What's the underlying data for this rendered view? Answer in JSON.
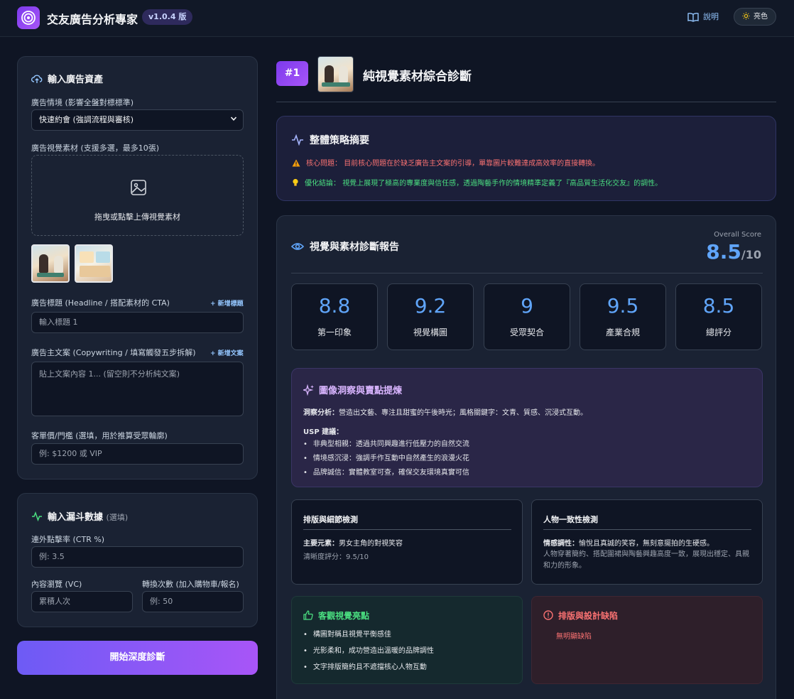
{
  "header": {
    "app_title": "交友廣告分析專家",
    "version": "v1.0.4 版",
    "help_label": "說明",
    "theme_label": "亮色"
  },
  "input_panel": {
    "title": "輸入廣告資產",
    "scenario_label": "廣告情境 (影響全盤對標標準)",
    "scenario_value": "快速約會 (強調流程與審核)",
    "visual_label": "廣告視覺素材 (支援多選，最多10張)",
    "dropzone_text": "拖曳或點擊上傳視覺素材",
    "headline_label": "廣告標題 (Headline / 搭配素材的 CTA)",
    "add_headline": "+ 新增標題",
    "headline_placeholder": "輸入標題 1",
    "copy_label": "廣告主文案 (Copywriting / 填寫觸發五步拆解)",
    "add_copy": "+ 新增文案",
    "copy_placeholder": "貼上文案內容 1... (留空則不分析純文案)",
    "price_label": "客單價/門檻 (選填，用於推算受眾輪廓)",
    "price_placeholder": "例: $1200 或 VIP"
  },
  "funnel_panel": {
    "title": "輸入漏斗數據",
    "optional": "(選填)",
    "ctr_label": "連外點擊率 (CTR %)",
    "ctr_placeholder": "例: 3.5",
    "vc_label": "內容瀏覽 (VC)",
    "vc_placeholder": "累積人次",
    "conv_label": "轉換次數 (加入購物車/報名)",
    "conv_placeholder": "例: 50"
  },
  "start_button": "開始深度診斷",
  "report_header": {
    "rank": "#1",
    "title": "純視覺素材綜合診斷"
  },
  "summary": {
    "title": "整體策略摘要",
    "core_label": "核心問題：",
    "core_text": "目前核心問題在於缺乏廣告主文案的引導，單靠圖片較難達成高效率的直接轉換。",
    "opt_label": "優化結論：",
    "opt_text": "視覺上展現了極高的專業度與信任感，透過陶藝手作的情境精準定義了『高品質生活化交友』的調性。"
  },
  "report": {
    "title": "視覺與素材診斷報告",
    "overall_label": "Overall Score",
    "overall_value": "8.5",
    "overall_denominator": "/10",
    "scores": [
      {
        "value": "8.8",
        "label": "第一印象"
      },
      {
        "value": "9.2",
        "label": "視覺構圖"
      },
      {
        "value": "9",
        "label": "受眾契合"
      },
      {
        "value": "9.5",
        "label": "產業合規"
      },
      {
        "value": "8.5",
        "label": "總評分"
      }
    ]
  },
  "insight": {
    "title": "圖像洞察與賣點提煉",
    "analysis_label": "洞察分析：",
    "analysis_text": "營造出文藝、專注且甜蜜的午後時光；風格關鍵字：文青、質感、沉浸式互動。",
    "usp_label": "USP 建議：",
    "usp": [
      "非典型相親：透過共同興趣進行低壓力的自然交流",
      "情境感沉浸：強調手作互動中自然產生的浪漫火花",
      "品牌誠信：實體教室可查，確保交友環境真實可信"
    ]
  },
  "layout_check": {
    "title": "排版與細節檢測",
    "main_label": "主要元素：",
    "main_text": "男女主角的對視笑容",
    "clarity": "清晰度評分：9.5/10"
  },
  "character_check": {
    "title": "人物一致性檢測",
    "emotion_label": "情感調性：",
    "emotion_text": "愉悅且真誠的笑容，無刻意擺拍的生硬感。",
    "desc": "人物穿著簡約、搭配圍裙與陶藝興趣高度一致，展現出穩定、具親和力的形象。"
  },
  "strengths": {
    "title": "客觀視覺亮點",
    "items": [
      "構圖對稱且視覺平衡感佳",
      "光影柔和，成功營造出溫暖的品牌調性",
      "文字排版簡約且不遮擋核心人物互動"
    ]
  },
  "defects": {
    "title": "排版與設計缺陷",
    "text": "無明顯缺陷"
  },
  "colors": {
    "accent_blue": "#60a5fa",
    "brand_purple": "#a855f7",
    "alert_red": "#f87171",
    "success_green": "#4ade80"
  }
}
